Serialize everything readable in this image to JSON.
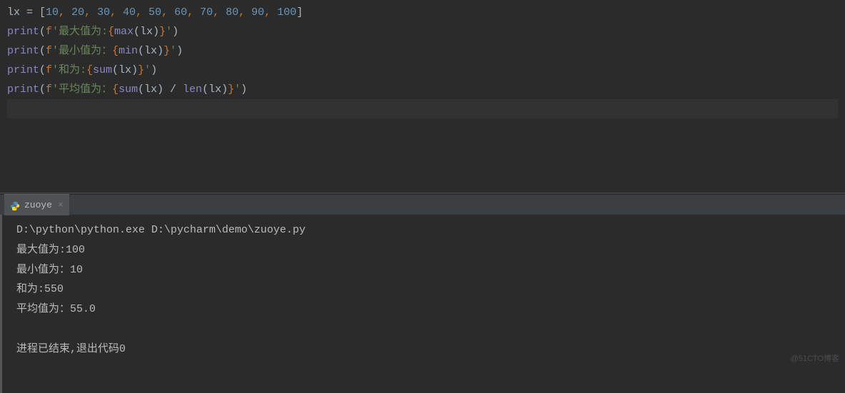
{
  "editor": {
    "lines": [
      {
        "var": "lx",
        "eq": " = ",
        "open": "[",
        "items": [
          "10",
          "20",
          "30",
          "40",
          "50",
          "60",
          "70",
          "80",
          "90",
          "100"
        ],
        "close": "]"
      },
      {
        "fn": "print",
        "open": "(",
        "f": "f",
        "q": "'",
        "text": "最大值为:",
        "braceO": "{",
        "expr_fn": "max",
        "expr_arg": "lx",
        "braceC": "}",
        "q2": "'",
        "close": ")"
      },
      {
        "fn": "print",
        "open": "(",
        "f": "f",
        "q": "'",
        "text": "最小值为：",
        "braceO": "{",
        "expr_fn": "min",
        "expr_arg": "lx",
        "braceC": "}",
        "q2": "'",
        "close": ")"
      },
      {
        "fn": "print",
        "open": "(",
        "f": "f",
        "q": "'",
        "text": "和为:",
        "braceO": "{",
        "expr_fn": "sum",
        "expr_arg": "lx",
        "braceC": "}",
        "q2": "'",
        "close": ")"
      },
      {
        "fn": "print",
        "open": "(",
        "f": "f",
        "q": "'",
        "text": "平均值为：",
        "braceO": "{",
        "expr_fn1": "sum",
        "expr_arg1": "lx",
        "op": " / ",
        "expr_fn2": "len",
        "expr_arg2": "lx",
        "braceC": "}",
        "q2": "'",
        "close": ")"
      }
    ]
  },
  "tab": {
    "name": "zuoye",
    "close": "×"
  },
  "console": {
    "cmd": "D:\\python\\python.exe D:\\pycharm\\demo\\zuoye.py",
    "out1": "最大值为:100",
    "out2": "最小值为：10",
    "out3": "和为:550",
    "out4": "平均值为：55.0",
    "exit": "进程已结束,退出代码0"
  },
  "watermark": "@51CTO博客"
}
